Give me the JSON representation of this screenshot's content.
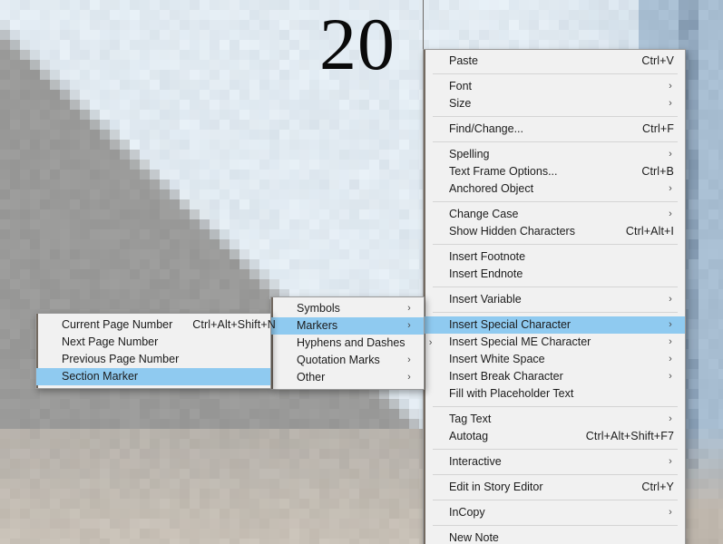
{
  "document": {
    "page_number": "20"
  },
  "colors": {
    "menu_background": "#f1f1f1",
    "menu_border": "#9a9a9a",
    "highlight": "#8fcaf0",
    "text": "#1b1b1b",
    "separator": "#d4d4d4",
    "canvas_blue": "#dde6ee",
    "canvas_gray": "#9a9a99",
    "canvas_tan": "#bdb5ab"
  },
  "icons": {
    "submenu_arrow": "submenu-arrow-icon",
    "glyph": "›"
  },
  "context_menu": {
    "name": "text-context-menu",
    "items": [
      {
        "type": "item",
        "label": "Paste",
        "accel": "Ctrl+V",
        "submenu": false,
        "selected": false
      },
      {
        "type": "separator"
      },
      {
        "type": "item",
        "label": "Font",
        "accel": "",
        "submenu": true,
        "selected": false
      },
      {
        "type": "item",
        "label": "Size",
        "accel": "",
        "submenu": true,
        "selected": false
      },
      {
        "type": "separator"
      },
      {
        "type": "item",
        "label": "Find/Change...",
        "accel": "Ctrl+F",
        "submenu": false,
        "selected": false
      },
      {
        "type": "separator"
      },
      {
        "type": "item",
        "label": "Spelling",
        "accel": "",
        "submenu": true,
        "selected": false
      },
      {
        "type": "item",
        "label": "Text Frame Options...",
        "accel": "Ctrl+B",
        "submenu": false,
        "selected": false
      },
      {
        "type": "item",
        "label": "Anchored Object",
        "accel": "",
        "submenu": true,
        "selected": false
      },
      {
        "type": "separator"
      },
      {
        "type": "item",
        "label": "Change Case",
        "accel": "",
        "submenu": true,
        "selected": false
      },
      {
        "type": "item",
        "label": "Show Hidden Characters",
        "accel": "Ctrl+Alt+I",
        "submenu": false,
        "selected": false
      },
      {
        "type": "separator"
      },
      {
        "type": "item",
        "label": "Insert Footnote",
        "accel": "",
        "submenu": false,
        "selected": false
      },
      {
        "type": "item",
        "label": "Insert Endnote",
        "accel": "",
        "submenu": false,
        "selected": false
      },
      {
        "type": "separator"
      },
      {
        "type": "item",
        "label": "Insert Variable",
        "accel": "",
        "submenu": true,
        "selected": false
      },
      {
        "type": "separator"
      },
      {
        "type": "item",
        "label": "Insert Special Character",
        "accel": "",
        "submenu": true,
        "selected": true
      },
      {
        "type": "item",
        "label": "Insert Special ME Character",
        "accel": "",
        "submenu": true,
        "selected": false
      },
      {
        "type": "item",
        "label": "Insert White Space",
        "accel": "",
        "submenu": true,
        "selected": false
      },
      {
        "type": "item",
        "label": "Insert Break Character",
        "accel": "",
        "submenu": true,
        "selected": false
      },
      {
        "type": "item",
        "label": "Fill with Placeholder Text",
        "accel": "",
        "submenu": false,
        "selected": false
      },
      {
        "type": "separator"
      },
      {
        "type": "item",
        "label": "Tag Text",
        "accel": "",
        "submenu": true,
        "selected": false
      },
      {
        "type": "item",
        "label": "Autotag",
        "accel": "Ctrl+Alt+Shift+F7",
        "submenu": false,
        "selected": false
      },
      {
        "type": "separator"
      },
      {
        "type": "item",
        "label": "Interactive",
        "accel": "",
        "submenu": true,
        "selected": false
      },
      {
        "type": "separator"
      },
      {
        "type": "item",
        "label": "Edit in Story Editor",
        "accel": "Ctrl+Y",
        "submenu": false,
        "selected": false
      },
      {
        "type": "separator"
      },
      {
        "type": "item",
        "label": "InCopy",
        "accel": "",
        "submenu": true,
        "selected": false
      },
      {
        "type": "separator"
      },
      {
        "type": "item",
        "label": "New Note",
        "accel": "",
        "submenu": false,
        "selected": false
      }
    ]
  },
  "special_character_submenu": {
    "name": "insert-special-character-submenu",
    "items": [
      {
        "type": "item",
        "label": "Symbols",
        "accel": "",
        "submenu": true,
        "selected": false
      },
      {
        "type": "item",
        "label": "Markers",
        "accel": "",
        "submenu": true,
        "selected": true
      },
      {
        "type": "item",
        "label": "Hyphens and Dashes",
        "accel": "",
        "submenu": true,
        "selected": false
      },
      {
        "type": "item",
        "label": "Quotation Marks",
        "accel": "",
        "submenu": true,
        "selected": false
      },
      {
        "type": "item",
        "label": "Other",
        "accel": "",
        "submenu": true,
        "selected": false
      }
    ]
  },
  "markers_submenu": {
    "name": "markers-submenu",
    "items": [
      {
        "type": "item",
        "label": "Current Page Number",
        "accel": "Ctrl+Alt+Shift+N",
        "submenu": false,
        "selected": false
      },
      {
        "type": "item",
        "label": "Next Page Number",
        "accel": "",
        "submenu": false,
        "selected": false
      },
      {
        "type": "item",
        "label": "Previous Page Number",
        "accel": "",
        "submenu": false,
        "selected": false
      },
      {
        "type": "item",
        "label": "Section Marker",
        "accel": "",
        "submenu": false,
        "selected": true
      }
    ]
  }
}
